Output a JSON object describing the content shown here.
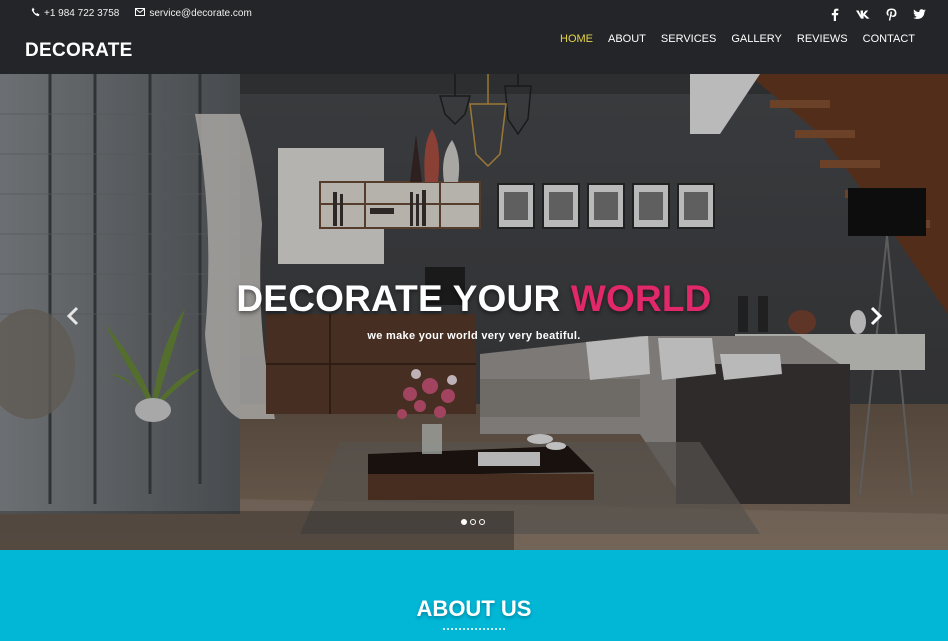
{
  "topbar": {
    "phone": "+1 984 722 3758",
    "email": "service@decorate.com",
    "phone_icon": "phone-icon",
    "email_icon": "envelope-icon"
  },
  "social": [
    "facebook-icon",
    "vk-icon",
    "pinterest-icon",
    "twitter-icon"
  ],
  "brand": {
    "logo": "DECORATE"
  },
  "nav": {
    "items": [
      {
        "label": "HOME",
        "active": true
      },
      {
        "label": "ABOUT"
      },
      {
        "label": "SERVICES"
      },
      {
        "label": "GALLERY"
      },
      {
        "label": "REVIEWS"
      },
      {
        "label": "CONTACT"
      }
    ]
  },
  "hero": {
    "title_main": "DECORATE YOUR",
    "title_accent": "WORLD",
    "subtitle": "we make your world very very beatiful.",
    "slides_count": 3,
    "active_slide": 1
  },
  "about": {
    "heading": "ABOUT US"
  },
  "colors": {
    "header_bg": "#232528",
    "nav_active": "#e6d44a",
    "accent_pink": "#e0286a",
    "about_bg": "#02b6d6"
  }
}
